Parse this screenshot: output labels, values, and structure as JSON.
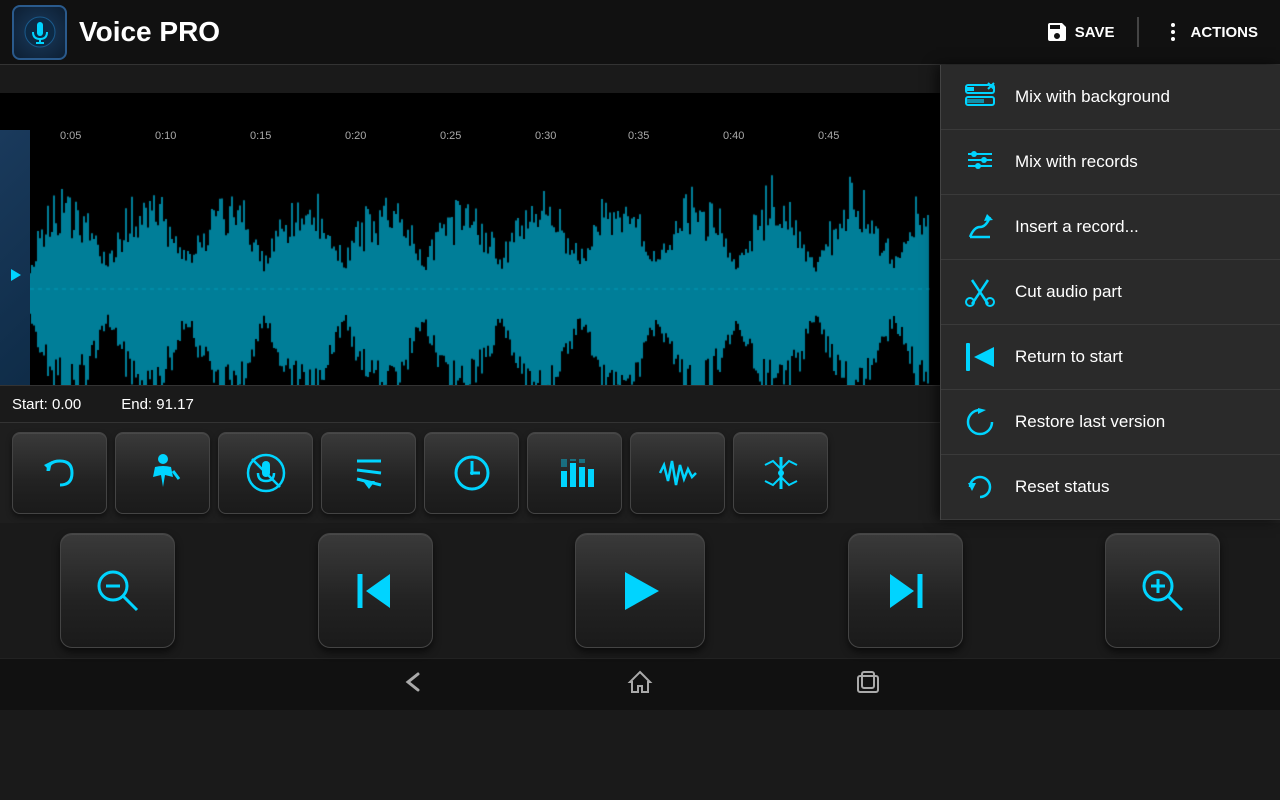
{
  "app": {
    "title": "Voice PRO"
  },
  "header": {
    "save_label": "SAVE",
    "actions_label": "ACTIONS"
  },
  "waveform": {
    "timeline_marks": [
      "0:05",
      "0:10",
      "0:15",
      "0:20",
      "0:25",
      "0:30",
      "0:35",
      "0:40",
      "0:45"
    ]
  },
  "status": {
    "start_label": "Start:",
    "start_value": "0.00",
    "end_label": "End:",
    "end_value": "91.17"
  },
  "menu": {
    "items": [
      {
        "id": "mix-background",
        "label": "Mix with background",
        "icon": "mix-bg-icon"
      },
      {
        "id": "mix-records",
        "label": "Mix with records",
        "icon": "mix-rec-icon"
      },
      {
        "id": "insert-record",
        "label": "Insert a record...",
        "icon": "insert-icon"
      },
      {
        "id": "cut-audio",
        "label": "Cut audio part",
        "icon": "cut-icon"
      },
      {
        "id": "return-start",
        "label": "Return to start",
        "icon": "return-icon"
      },
      {
        "id": "restore-last",
        "label": "Restore last version",
        "icon": "restore-icon"
      },
      {
        "id": "reset-status",
        "label": "Reset status",
        "icon": "reset-icon"
      }
    ]
  },
  "toolbar": {
    "buttons": [
      {
        "id": "undo",
        "label": "Undo"
      },
      {
        "id": "trim-silence",
        "label": "Trim silence"
      },
      {
        "id": "mute",
        "label": "Mute"
      },
      {
        "id": "pitch-down",
        "label": "Pitch down"
      },
      {
        "id": "clock",
        "label": "Clock"
      },
      {
        "id": "equalizer",
        "label": "Equalizer"
      },
      {
        "id": "waveform-fx",
        "label": "Waveform FX"
      },
      {
        "id": "enhance",
        "label": "Enhance"
      }
    ]
  },
  "playback": {
    "buttons": [
      {
        "id": "zoom-out",
        "label": "Zoom out"
      },
      {
        "id": "skip-back",
        "label": "Skip to start"
      },
      {
        "id": "play",
        "label": "Play"
      },
      {
        "id": "skip-forward",
        "label": "Skip to end"
      },
      {
        "id": "zoom-in",
        "label": "Zoom in"
      }
    ]
  },
  "navbar": {
    "back": "back",
    "home": "home",
    "recents": "recents"
  },
  "colors": {
    "cyan": "#00d4ff",
    "dark_bg": "#1a1a1a",
    "menu_bg": "#2a2a2a"
  }
}
